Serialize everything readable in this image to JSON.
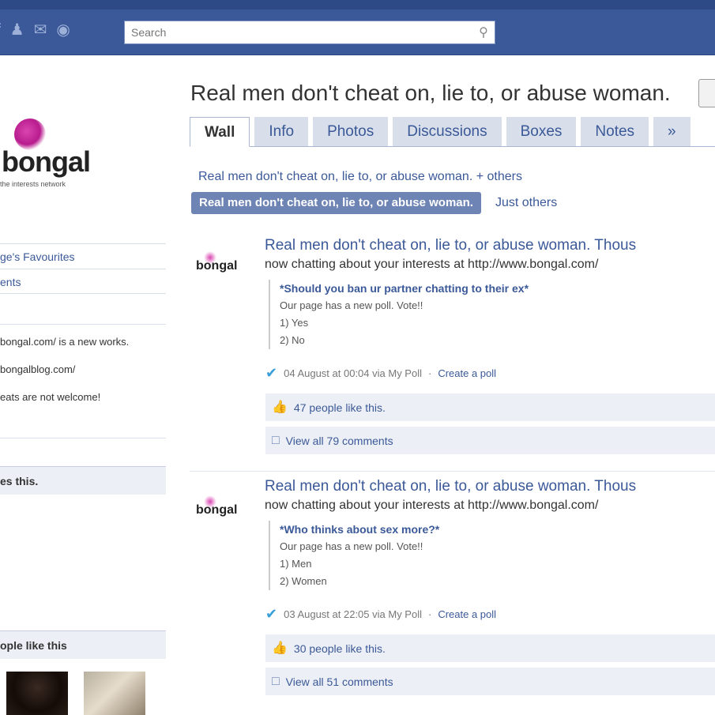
{
  "search": {
    "placeholder": "Search"
  },
  "left": {
    "logo_text": "bongal",
    "logo_sub": "the interests network",
    "links": [
      "ge's Favourites",
      "ents"
    ],
    "info": [
      "bongal.com/ is a new works.",
      "bongalblog.com/",
      "eats are not welcome!"
    ],
    "likes_head": "es this.",
    "people_head": "ople like this"
  },
  "page": {
    "title": "Real men don't cheat on, lie to, or abuse woman.",
    "tabs": [
      "Wall",
      "Info",
      "Photos",
      "Discussions",
      "Boxes",
      "Notes",
      "»"
    ]
  },
  "filter": {
    "line": "Real men don't cheat on, lie to, or abuse woman. + others",
    "pill": "Real men don't cheat on, lie to, or abuse woman.",
    "other": "Just others"
  },
  "stories": [
    {
      "logo": "bongal",
      "head": "Real men don't cheat on, lie to, or abuse woman. Thous",
      "sub": "now chatting about your interests at http://www.bongal.com/",
      "poll_q": "*Should you ban ur partner chatting to their ex*",
      "poll_intro": "Our page has a new poll. Vote!!",
      "opt1": "1) Yes",
      "opt2": "2) No",
      "meta_time": "04 August at 00:04 via My Poll",
      "meta_link": "Create a poll",
      "likes": "47 people like this.",
      "comments": "View all 79 comments"
    },
    {
      "logo": "bongal",
      "head": "Real men don't cheat on, lie to, or abuse woman. Thous",
      "sub": "now chatting about your interests at http://www.bongal.com/",
      "poll_q": "*Who thinks about sex more?*",
      "poll_intro": "Our page has a new poll. Vote!!",
      "opt1": "1) Men",
      "opt2": "2) Women",
      "meta_time": "03 August at 22:05 via My Poll",
      "meta_link": "Create a poll",
      "likes": "30 people like this.",
      "comments": "View all 51 comments"
    }
  ]
}
